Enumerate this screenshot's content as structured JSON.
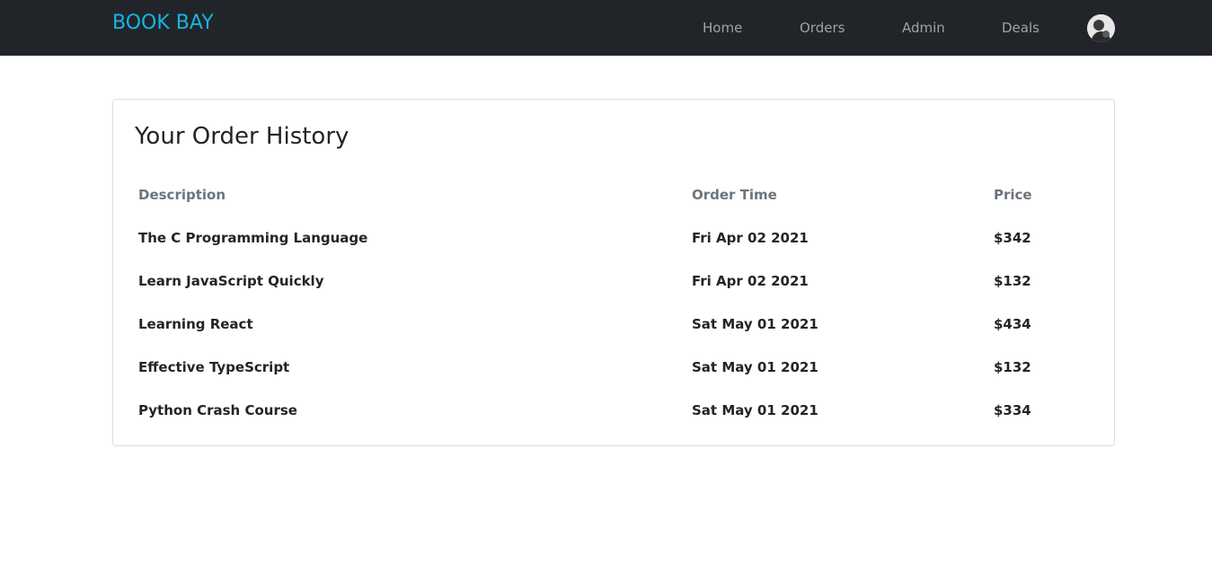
{
  "navbar": {
    "brand": "BOOK BAY",
    "links": [
      {
        "label": "Home"
      },
      {
        "label": "Orders"
      },
      {
        "label": "Admin"
      },
      {
        "label": "Deals"
      }
    ]
  },
  "colors": {
    "navbar_bg": "#212529",
    "brand": "#17b5e0",
    "nav_link": "#9ea3a8",
    "header_text": "#6c757d",
    "body_text": "#212529"
  },
  "page": {
    "title": "Your Order History"
  },
  "table": {
    "headers": {
      "description": "Description",
      "order_time": "Order Time",
      "price": "Price"
    },
    "rows": [
      {
        "description": "The C Programming Language",
        "order_time": "Fri Apr 02 2021",
        "price": "$342"
      },
      {
        "description": "Learn JavaScript Quickly",
        "order_time": "Fri Apr 02 2021",
        "price": "$132"
      },
      {
        "description": "Learning React",
        "order_time": "Sat May 01 2021",
        "price": "$434"
      },
      {
        "description": "Effective TypeScript",
        "order_time": "Sat May 01 2021",
        "price": "$132"
      },
      {
        "description": "Python Crash Course",
        "order_time": "Sat May 01 2021",
        "price": "$334"
      }
    ]
  }
}
